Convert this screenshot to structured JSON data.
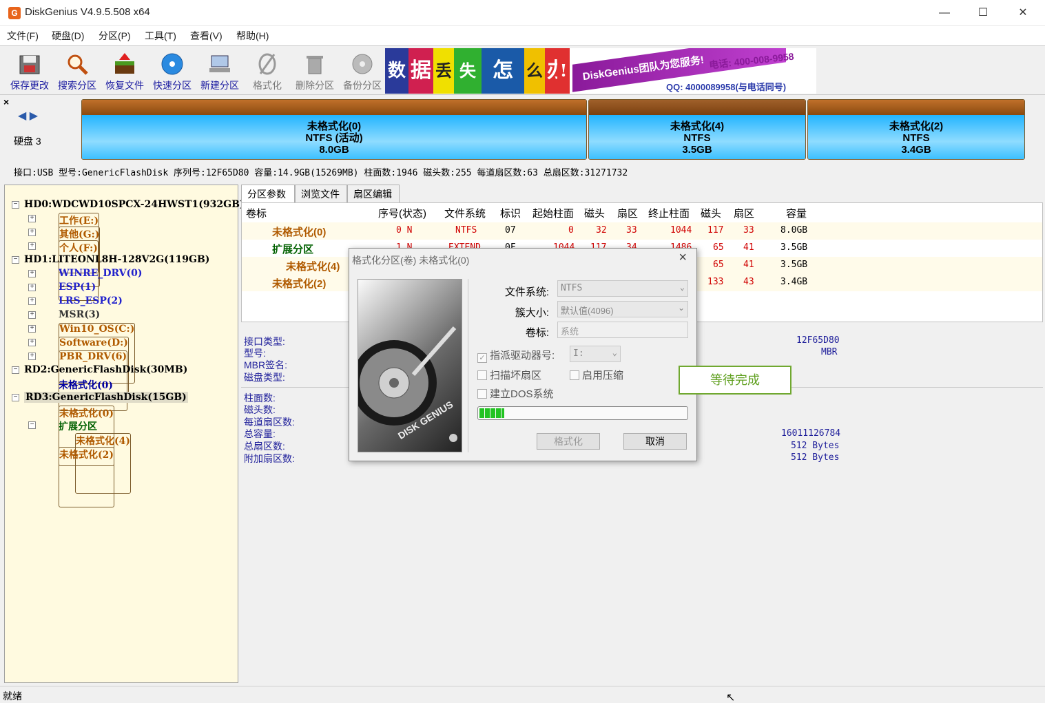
{
  "window": {
    "title": "DiskGenius V4.9.5.508 x64",
    "icon": "G",
    "minimize": "—",
    "maximize": "☐",
    "close": "✕"
  },
  "menu": [
    "文件(F)",
    "硬盘(D)",
    "分区(P)",
    "工具(T)",
    "查看(V)",
    "帮助(H)"
  ],
  "toolbar": {
    "buttons": [
      {
        "label": "保存更改",
        "icon": "save-disk-icon"
      },
      {
        "label": "搜索分区",
        "icon": "magnifier-icon"
      },
      {
        "label": "恢复文件",
        "icon": "recover-box-icon"
      },
      {
        "label": "快速分区",
        "icon": "disc-icon"
      },
      {
        "label": "新建分区",
        "icon": "new-partition-icon"
      },
      {
        "label": "格式化",
        "icon": "format-icon"
      },
      {
        "label": "删除分区",
        "icon": "trash-icon"
      },
      {
        "label": "备份分区",
        "icon": "backup-icon"
      }
    ]
  },
  "banner": {
    "tiles": [
      "数",
      "据",
      "丢",
      "失",
      "怎",
      "么",
      "办",
      "!"
    ],
    "brand": "DiskGenius团队为您服务!",
    "phone": "电话: 400-008-9958",
    "qq": "QQ: 4000089958(与电话同号)"
  },
  "diskmap": {
    "nav": "◀ ▶",
    "disk_label": "硬盘 3",
    "partitions": [
      {
        "name": "未格式化(0)",
        "fs": "NTFS (活动)",
        "size": "8.0GB"
      },
      {
        "name": "未格式化(4)",
        "fs": "NTFS",
        "size": "3.5GB"
      },
      {
        "name": "未格式化(2)",
        "fs": "NTFS",
        "size": "3.4GB"
      }
    ],
    "info": "接口:USB  型号:GenericFlashDisk  序列号:12F65D80  容量:14.9GB(15269MB)  柱面数:1946  磁头数:255  每道扇区数:63  总扇区数:31271732"
  },
  "tree": {
    "items": [
      {
        "text": "HD0:WDCWD10SPCX-24HWST1(932GB)",
        "kind": "disk"
      },
      {
        "text": "工作(E:)",
        "kind": "part"
      },
      {
        "text": "其他(G:)",
        "kind": "part"
      },
      {
        "text": "个人(F:)",
        "kind": "part"
      },
      {
        "text": "HD1:LITEONL8H-128V2G(119GB)",
        "kind": "disk"
      },
      {
        "text": "WINRE_DRV(0)",
        "kind": "sys"
      },
      {
        "text": "ESP(1)",
        "kind": "sys"
      },
      {
        "text": "LRS_ESP(2)",
        "kind": "sys"
      },
      {
        "text": "MSR(3)",
        "kind": "dark"
      },
      {
        "text": "Win10_OS(C:)",
        "kind": "part"
      },
      {
        "text": "Software(D:)",
        "kind": "part"
      },
      {
        "text": "PBR_DRV(6)",
        "kind": "part"
      },
      {
        "text": "RD2:GenericFlashDisk(30MB)",
        "kind": "disk"
      },
      {
        "text": "未格式化(0)",
        "kind": "sel"
      },
      {
        "text": "RD3:GenericFlashDisk(15GB)",
        "kind": "disk"
      },
      {
        "text": "未格式化(0)",
        "kind": "part"
      },
      {
        "text": "扩展分区",
        "kind": "ext"
      },
      {
        "text": "未格式化(4)",
        "kind": "part"
      },
      {
        "text": "未格式化(2)",
        "kind": "part"
      }
    ]
  },
  "tabs": [
    "分区参数",
    "浏览文件",
    "扇区编辑"
  ],
  "table": {
    "headers": [
      "卷标",
      "序号(状态)",
      "文件系统",
      "标识",
      "起始柱面",
      "磁头",
      "扇区",
      "终止柱面",
      "磁头",
      "扇区",
      "容量"
    ],
    "rows": [
      {
        "label": "未格式化(0)",
        "seq": "0 N",
        "fs": "NTFS",
        "id": "07",
        "sc": "0",
        "sh": "32",
        "ss": "33",
        "ec": "1044",
        "eh": "117",
        "es": "33",
        "size": "8.0GB"
      },
      {
        "label": "扩展分区",
        "seq": "1 N",
        "fs": "EXTEND",
        "id": "0F",
        "sc": "1044",
        "sh": "117",
        "ss": "34",
        "ec": "1486",
        "eh": "65",
        "es": "41",
        "size": "3.5GB"
      },
      {
        "label": "未格式化(4)",
        "seq": "",
        "fs": "",
        "id": "",
        "sc": "",
        "sh": "",
        "ss": "",
        "ec": "",
        "eh": "65",
        "es": "41",
        "size": "3.5GB"
      },
      {
        "label": "未格式化(2)",
        "seq": "",
        "fs": "",
        "id": "",
        "sc": "",
        "sh": "",
        "ss": "",
        "ec": "",
        "eh": "133",
        "es": "43",
        "size": "3.4GB"
      }
    ]
  },
  "details": {
    "labels_top": [
      "接口类型:",
      "型号:",
      "MBR签名:",
      "磁盘类型:"
    ],
    "values_top": [
      "12F65D80",
      "MBR"
    ],
    "labels_bottom": [
      "柱面数:",
      "磁头数:",
      "每道扇区数:",
      "总容量:",
      "总扇区数:",
      "附加扇区数:"
    ],
    "values_bottom": [
      "16011126784",
      "512 Bytes",
      "512 Bytes"
    ]
  },
  "dialog": {
    "title": "格式化分区(卷) 未格式化(0)",
    "fs_label": "文件系统:",
    "fs_value": "NTFS",
    "cluster_label": "簇大小:",
    "cluster_value": "默认值(4096)",
    "volume_label": "卷标:",
    "volume_value": "系统",
    "assign_drive": "指派驱动器号:",
    "drive_value": "I:",
    "scan_bad": "扫描坏扇区",
    "compress": "启用压缩",
    "dos": "建立DOS系统",
    "progress_percent": 12,
    "format_btn": "格式化",
    "cancel_btn": "取消",
    "hdd_text": "DISK GENIUS"
  },
  "waiting": "等待完成",
  "status": "就绪",
  "colors": {
    "accent_orange": "#b05a00",
    "partition_blue": "#22b4ff",
    "progress_green": "#22c322"
  }
}
